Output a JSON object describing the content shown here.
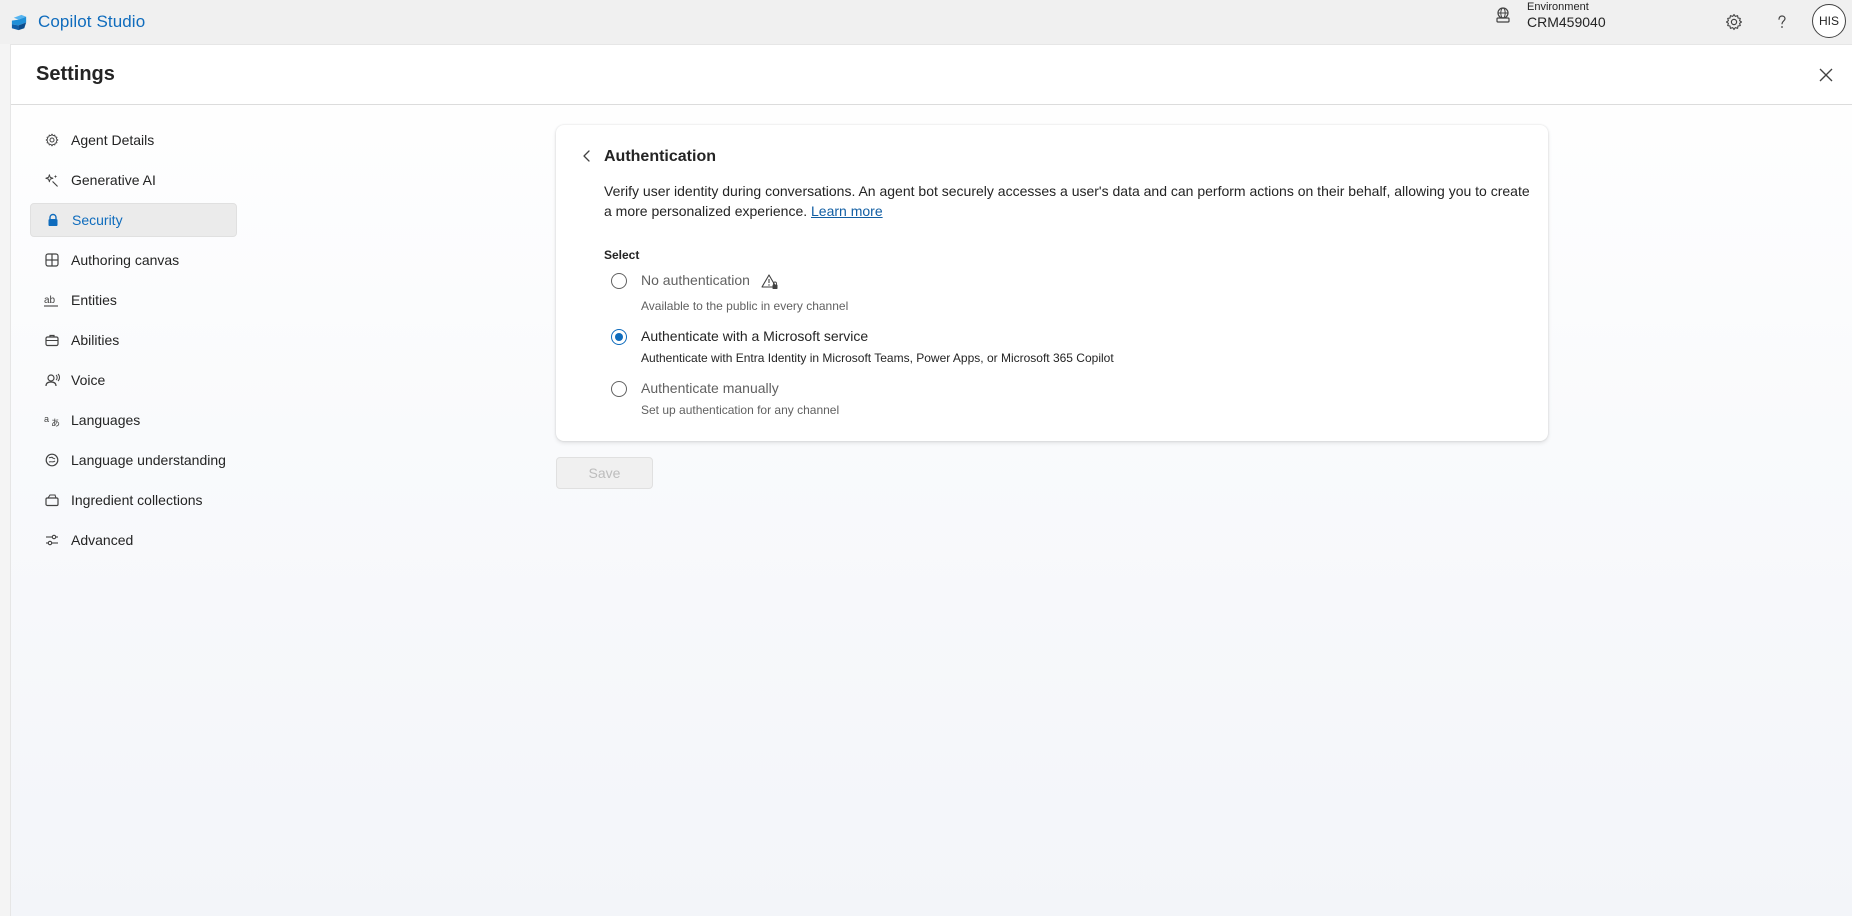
{
  "app": {
    "name": "Copilot Studio",
    "brand_color": "#0f6cbd"
  },
  "topbar": {
    "environment_label": "Environment",
    "environment_value": "CRM459040",
    "avatar_initials": "HIS",
    "icons": [
      "environment-icon",
      "settings-icon",
      "help-icon"
    ]
  },
  "settings": {
    "title": "Settings",
    "nav": [
      {
        "label": "Agent Details",
        "icon": "gear-icon",
        "active": false
      },
      {
        "label": "Generative AI",
        "icon": "sparkle-icon",
        "active": false
      },
      {
        "label": "Security",
        "icon": "lock-icon",
        "active": true
      },
      {
        "label": "Authoring canvas",
        "icon": "grid-icon",
        "active": false
      },
      {
        "label": "Entities",
        "icon": "entity-icon",
        "active": false
      },
      {
        "label": "Abilities",
        "icon": "briefcase-icon",
        "active": false
      },
      {
        "label": "Voice",
        "icon": "voice-icon",
        "active": false
      },
      {
        "label": "Languages",
        "icon": "translate-icon",
        "active": false
      },
      {
        "label": "Language understanding",
        "icon": "brain-icon",
        "active": false
      },
      {
        "label": "Ingredient collections",
        "icon": "collection-icon",
        "active": false
      },
      {
        "label": "Advanced",
        "icon": "sliders-icon",
        "active": false
      }
    ]
  },
  "auth": {
    "title": "Authentication",
    "description": "Verify user identity during conversations. An agent bot securely accesses a user's data and can perform actions on their behalf, allowing you to create a more personalized experience.",
    "learn_more": "Learn more",
    "select_label": "Select",
    "options": [
      {
        "label": "No authentication",
        "description": "Available to the public in every channel",
        "selected": false
      },
      {
        "label": "Authenticate with a Microsoft service",
        "description": "Authenticate with Entra Identity in Microsoft Teams, Power Apps, or Microsoft 365 Copilot",
        "selected": true
      },
      {
        "label": "Authenticate manually",
        "description": "Set up authentication for any channel",
        "selected": false
      }
    ],
    "save_label": "Save"
  }
}
